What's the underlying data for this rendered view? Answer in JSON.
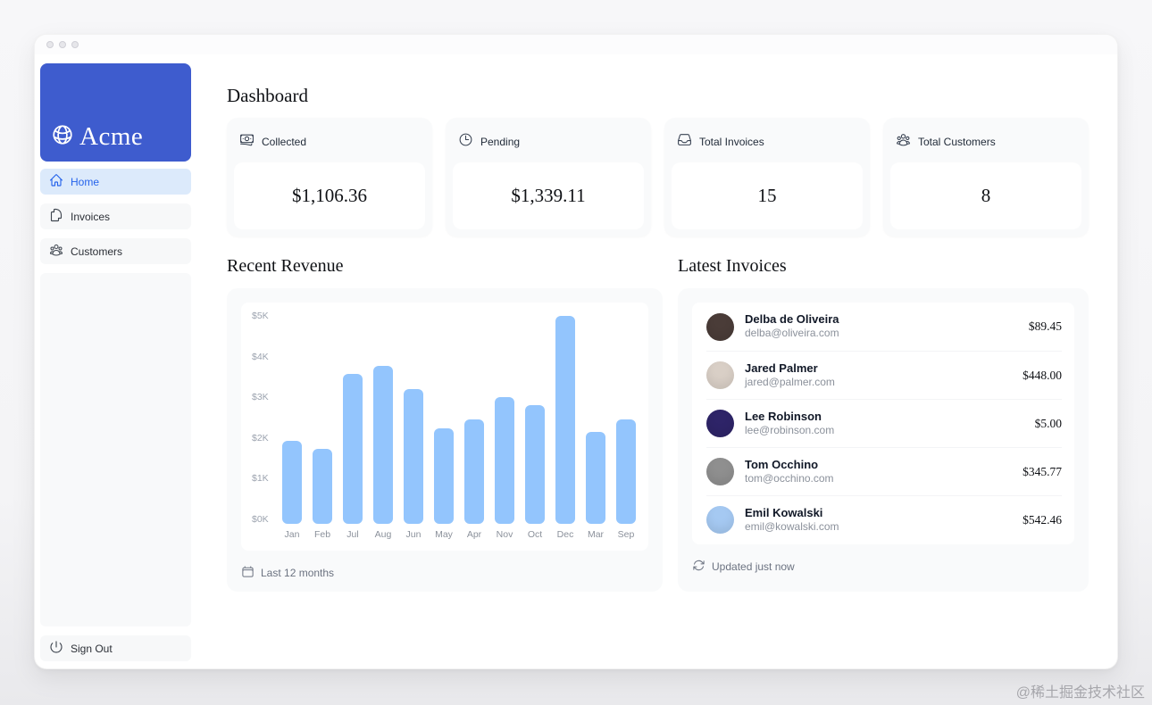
{
  "sidebar": {
    "brand": "Acme",
    "items": [
      {
        "label": "Home",
        "active": true
      },
      {
        "label": "Invoices",
        "active": false
      },
      {
        "label": "Customers",
        "active": false
      }
    ],
    "sign_out_label": "Sign Out"
  },
  "header": {
    "title": "Dashboard"
  },
  "stat_cards": [
    {
      "label": "Collected",
      "value": "$1,106.36",
      "icon": "banknotes-icon"
    },
    {
      "label": "Pending",
      "value": "$1,339.11",
      "icon": "clock-icon"
    },
    {
      "label": "Total Invoices",
      "value": "15",
      "icon": "inbox-icon"
    },
    {
      "label": "Total Customers",
      "value": "8",
      "icon": "user-group-icon"
    }
  ],
  "revenue_panel": {
    "title": "Recent Revenue",
    "footer": "Last 12 months"
  },
  "chart_data": {
    "type": "bar",
    "title": "Recent Revenue",
    "categories": [
      "Jan",
      "Feb",
      "Jul",
      "Aug",
      "Jun",
      "May",
      "Apr",
      "Nov",
      "Oct",
      "Dec",
      "Mar",
      "Sep"
    ],
    "values": [
      2000,
      1800,
      3600,
      3800,
      3250,
      2300,
      2500,
      3050,
      2850,
      5000,
      2200,
      2500
    ],
    "yticks": [
      "$5K",
      "$4K",
      "$3K",
      "$2K",
      "$1K",
      "$0K"
    ],
    "ylim": [
      0,
      5000
    ],
    "ylabel": "",
    "xlabel": "",
    "grid": false,
    "legend": "none",
    "bar_color": "#93c5fd"
  },
  "latest_invoices": {
    "title": "Latest Invoices",
    "footer": "Updated just now",
    "rows": [
      {
        "name": "Delba de Oliveira",
        "email": "delba@oliveira.com",
        "amount": "$89.45",
        "avatar_color": "#4a3c38"
      },
      {
        "name": "Jared Palmer",
        "email": "jared@palmer.com",
        "amount": "$448.00",
        "avatar_color": "#d9cfc6"
      },
      {
        "name": "Lee Robinson",
        "email": "lee@robinson.com",
        "amount": "$5.00",
        "avatar_color": "#2e2468"
      },
      {
        "name": "Tom Occhino",
        "email": "tom@occhino.com",
        "amount": "$345.77",
        "avatar_color": "#8f8f8f"
      },
      {
        "name": "Emil Kowalski",
        "email": "emil@kowalski.com",
        "amount": "$542.46",
        "avatar_color": "#a5c9f2"
      }
    ]
  },
  "watermark": "@稀土掘金技术社区",
  "colors": {
    "logo_bg": "#3e5cce",
    "active_item_bg": "#dceafb",
    "active_item_text": "#2563eb",
    "bar": "#93c5fd",
    "card_bg": "#f9fafb"
  }
}
